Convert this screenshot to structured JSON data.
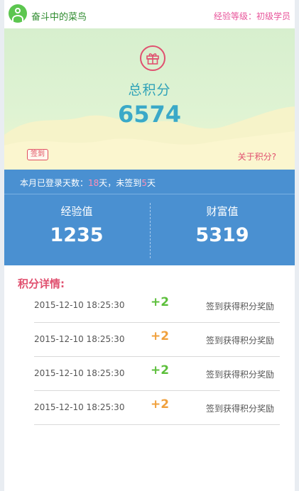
{
  "header": {
    "username": "奋斗中的菜鸟",
    "level": "经验等级：初级学员",
    "avatar_icon": "user-icon"
  },
  "hero": {
    "gift_icon": "gift-icon",
    "total_label": "总积分",
    "total_value": "6574",
    "checkin_label": "签到",
    "about_link": "关于积分?"
  },
  "summary": {
    "login_prefix": "本月已登录天数：",
    "login_days": "18",
    "login_middle": "天，未签到",
    "unsigned_days": "5",
    "login_suffix": "天",
    "exp_label": "经验值",
    "exp_value": "1235",
    "wealth_label": "财富值",
    "wealth_value": "5319"
  },
  "details": {
    "title": "积分详情:",
    "rows": [
      {
        "time": "2015-12-10 18:25:30",
        "points": "+2",
        "desc": "签到获得积分奖励",
        "color": "#5cbf3b"
      },
      {
        "time": "2015-12-10 18:25:30",
        "points": "+2",
        "desc": "签到获得积分奖励",
        "color": "#f0a03c"
      },
      {
        "time": "2015-12-10 18:25:30",
        "points": "+2",
        "desc": "签到获得积分奖励",
        "color": "#5cbf3b"
      },
      {
        "time": "2015-12-10 18:25:30",
        "points": "+2",
        "desc": "签到获得积分奖励",
        "color": "#f0a03c"
      }
    ]
  },
  "colors": {
    "accent_pink": "#e0506f",
    "accent_blue": "#4a90d1",
    "plus_green": "#5cbf3b",
    "plus_orange": "#f0a03c"
  }
}
